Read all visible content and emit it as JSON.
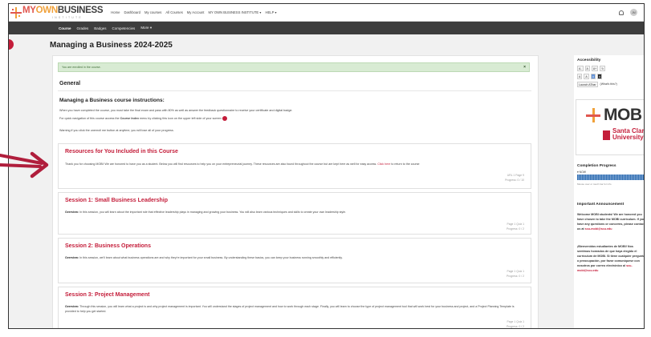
{
  "brand": {
    "name_part1": "MY",
    "name_part2": "OWN",
    "name_part3": "BUSINESS",
    "tagline": "INSTITUTE"
  },
  "top_nav": [
    "Home",
    "Dashboard",
    "My courses",
    "All Courses",
    "My Account",
    "MY OWN BUSINESS INSTITUTE ▾",
    "HELP ▾"
  ],
  "user": {
    "avatar_initials": "JM"
  },
  "course_nav": [
    {
      "label": "Course",
      "active": true
    },
    {
      "label": "Grades",
      "active": false
    },
    {
      "label": "Badges",
      "active": false
    },
    {
      "label": "Competencies",
      "active": false
    },
    {
      "label": "More ▾",
      "active": false
    }
  ],
  "page_title": "Managing a Business 2024-2025",
  "notice": {
    "text": "You are enrolled in the course.",
    "close": "×"
  },
  "general_heading": "General",
  "instructions": {
    "title": "Managing a Business course instructions:",
    "p1": "When you have completed the course, you must take the final exam and pass with 80% as well as answer the feedback questionnaire to receive your certificate and digital badge.",
    "p2_pre": "For quick navigation of this course access the ",
    "p2_bold": "Course Index",
    "p2_post": " menu by clicking this icon on the upper left side of your screen",
    "p3": "Warning if you click the unenroll me button at anytime, you will lose all of your progress."
  },
  "sections": [
    {
      "title": "Resources for You Included in this Course",
      "desc_pre": "Thank you for choosing MOBI! We are honored to have you as a student.  Below you will find resources to help you on your entrepreneurial journey.  These resources are also found throughout the course but are kept here as well for easy access.",
      "link": "Click here",
      "desc_post": " to return to the course",
      "meta1": "URL 1  Page 9",
      "meta2": "Progress: 0 / 10"
    },
    {
      "title": "Session 1: Small Business Leadership",
      "desc_label": "Overview:",
      "desc": " In this session, you will learn about the important role that effective leadership plays in managing and growing your business. You will also learn various techniques and skills to create your own leadership style.",
      "meta1": "Page 1  Quiz 1",
      "meta2": "Progress: 0 / 2"
    },
    {
      "title": "Session 2: Business Operations",
      "desc_label": "Overview:",
      "desc": " In this session, we'll learn about what business operations are and why they're important for your small business. By understanding these basics, you can keep your business running smoothly and efficiently.",
      "meta1": "Page 1  Quiz 1",
      "meta2": "Progress: 0 / 2"
    },
    {
      "title": "Session 3: Project Management",
      "desc_label": "Overview:",
      "desc": " Through this session, you will learn what a project is and why project management is important. You will understand the stages of project management and how to work through each stage. Finally, you will learn to choose the type of project management tool that will work best for your business and project, and a Project Planning Template is provided to help you get started.",
      "meta1": "Page 1  Quiz 1",
      "meta2": "Progress: 0 / 2"
    }
  ],
  "sidebar": {
    "accessibility": {
      "title": "Accessibility",
      "row1": [
        "A-",
        "A",
        "A+",
        "↻"
      ],
      "row2": [
        "A",
        "A",
        "A",
        "A"
      ],
      "launch": "Launch ATbar",
      "whats_this": "(What's this?)"
    },
    "logo": {
      "mob": "MOB",
      "scu1": "Santa Clar",
      "scu2": "University"
    },
    "completion": {
      "title": "Completion Progress",
      "label": "▾ NOW",
      "caption": "Mouse over or touch bar for info"
    },
    "announcement": {
      "title": "Important Announcement",
      "p1": "Welcome MOBI students!  We are honored you have chosen to take the MOBI curriculum.  If you have any questions or concerns, please contact us at ",
      "p1_link": "scu-mobi@scu.edu",
      "p2": "¡Bienvenidos estudiantes de MOBI! Nos sentimos honrados de que haya elegido el currículum de MOBI.  Si tiene cualquier pregunta o preocupación, por favor comuníquese con nosotros por correo electrónico al ",
      "p2_link": "scu-mobi@scu.edu"
    }
  },
  "colors": {
    "accent": "#c41d3a",
    "subnav": "#3d3d3d",
    "notice_bg": "#d8ebd3",
    "progress": "#2d6cb0"
  }
}
